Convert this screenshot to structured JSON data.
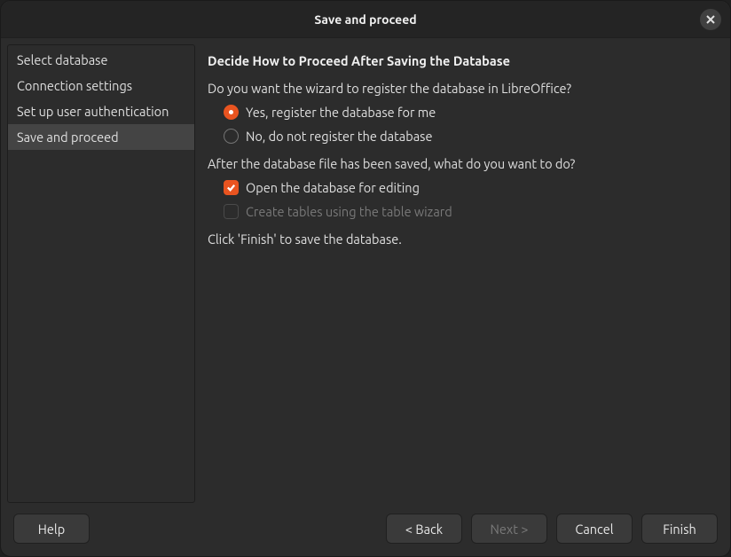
{
  "window": {
    "title": "Save and proceed"
  },
  "sidebar": {
    "items": [
      {
        "label": "Select database",
        "active": false
      },
      {
        "label": "Connection settings",
        "active": false
      },
      {
        "label": "Set up user authentication",
        "active": false
      },
      {
        "label": "Save and proceed",
        "active": true
      }
    ]
  },
  "content": {
    "heading": "Decide How to Proceed After Saving the Database",
    "register_question": "Do you want the wizard to register the database in LibreOffice?",
    "register_yes": "Yes, register the database for me",
    "register_no": "No, do not register the database",
    "register_selected": "yes",
    "after_save_question": "After the database file has been saved, what do you want to do?",
    "open_for_editing_label": "Open the database for editing",
    "open_for_editing_checked": true,
    "create_tables_label": "Create tables using the table wizard",
    "create_tables_checked": false,
    "create_tables_disabled": true,
    "finish_hint": "Click 'Finish' to save the database."
  },
  "footer": {
    "help": "Help",
    "back": "< Back",
    "next": "Next >",
    "next_disabled": true,
    "cancel": "Cancel",
    "finish": "Finish"
  }
}
